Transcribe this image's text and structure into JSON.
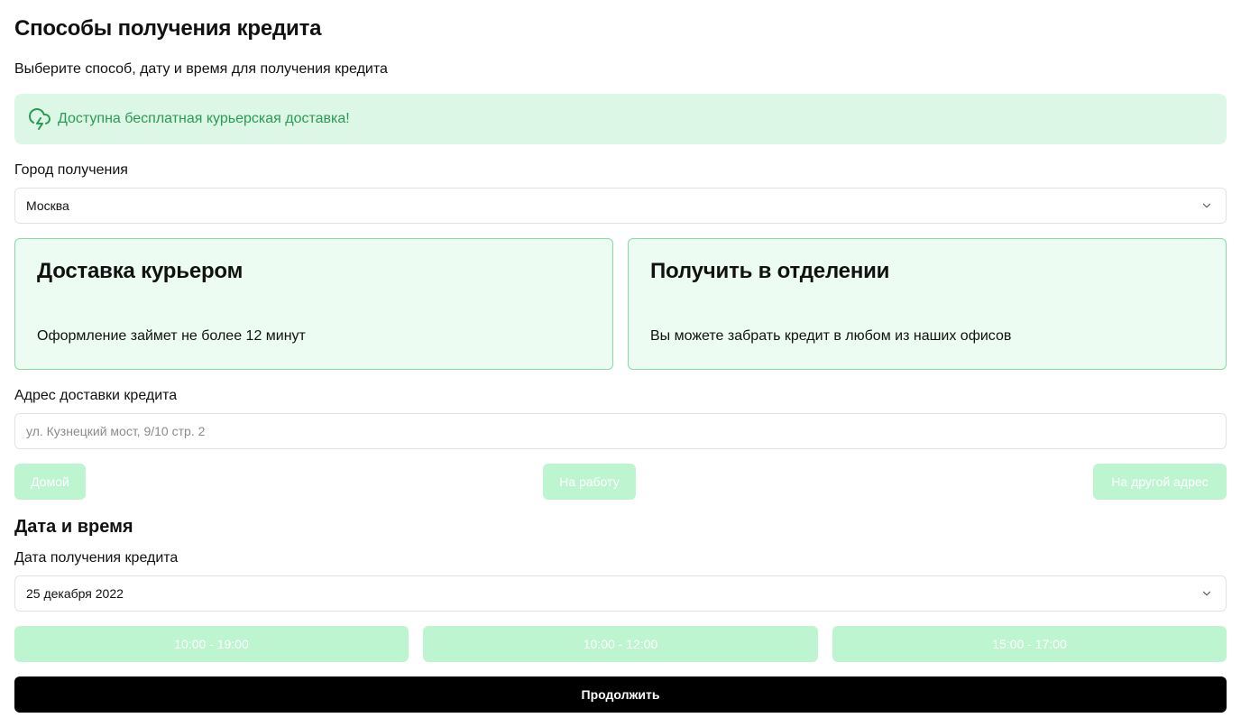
{
  "header": {
    "title": "Способы получения кредита",
    "subtitle": "Выберите способ, дату и время для получения кредита"
  },
  "notice": {
    "icon": "cloud-lightning-icon",
    "text": "Доступна бесплатная курьерская доставка!",
    "color": "#2b9a57",
    "background": "#dcf7e5"
  },
  "city": {
    "label": "Город получения",
    "value": "Москва"
  },
  "methods": [
    {
      "title": "Доставка курьером",
      "description": "Оформление займет не более 12 минут"
    },
    {
      "title": "Получить в отделении",
      "description": "Вы можете забрать кредит в любом из наших офисов"
    }
  ],
  "address": {
    "label": "Адрес доставки кредита",
    "placeholder": "ул. Кузнецкий мост, 9/10 стр. 2",
    "shortcuts": [
      "Домой",
      "На работу",
      "На другой адрес"
    ]
  },
  "datetime": {
    "section_title": "Дата и время",
    "date_label": "Дата получения кредита",
    "date_value": "25 декабря 2022",
    "time_slots": [
      "10:00 - 19:00",
      "10:00 - 12:00",
      "15:00 - 17:00"
    ]
  },
  "actions": {
    "continue_label": "Продолжить"
  },
  "colors": {
    "accent_light": "#bdf5d1",
    "card_bg": "#edfcf2",
    "card_border": "#86dca4",
    "primary_button": "#000000"
  }
}
